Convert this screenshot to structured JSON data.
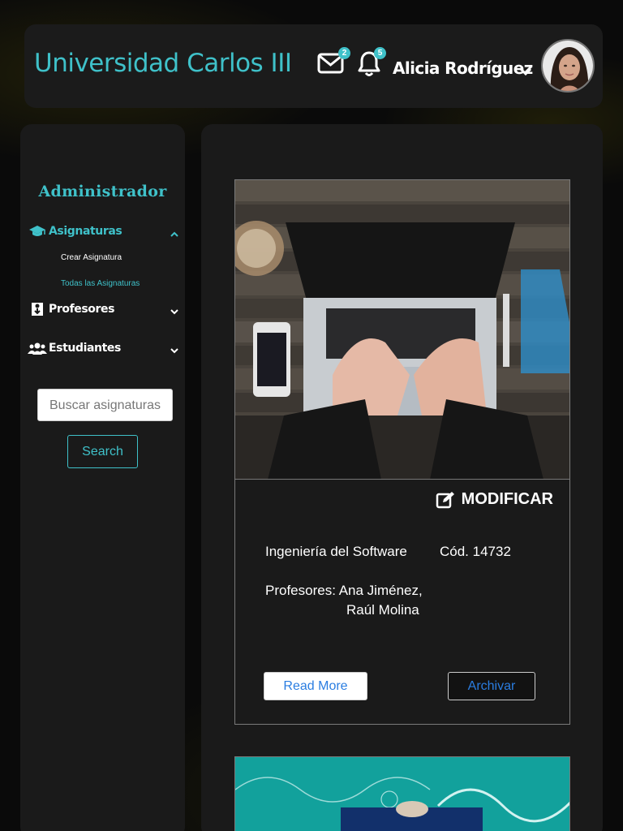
{
  "header": {
    "brand": "Universidad Carlos III",
    "messages_count": "2",
    "notifications_count": "5",
    "user_name": "Alicia Rodríguez"
  },
  "sidebar": {
    "title": "Administrador",
    "sections": [
      {
        "label": "Asignaturas",
        "icon": "graduation-cap-icon",
        "expanded": true,
        "items": [
          "Crear Asignatura",
          "Todas las Asignaturas"
        ]
      },
      {
        "label": "Profesores",
        "icon": "professor-icon",
        "expanded": false
      },
      {
        "label": "Estudiantes",
        "icon": "users-icon",
        "expanded": false
      }
    ],
    "search_placeholder": "Buscar asignaturas",
    "search_button": "Search"
  },
  "course": {
    "modify_label": "MODIFICAR",
    "name": "Ingeniería del Software",
    "code": "Cód. 14732",
    "professors_label": "Profesores: Ana Jiménez,",
    "professors_line2": "Raúl Molina",
    "read_more": "Read More",
    "archive": "Archivar"
  },
  "colors": {
    "accent": "#3fc1c9",
    "link": "#2a7de1",
    "panel": "#1a1a1a"
  }
}
